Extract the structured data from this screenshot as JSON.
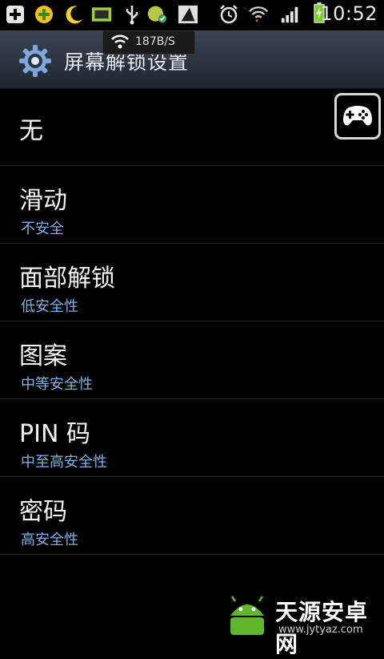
{
  "status_bar": {
    "time": "10:52",
    "net_speed": "187B/S",
    "icons": [
      "plus-icon",
      "coin-app-icon",
      "moon-icon",
      "sim-icon",
      "usb-icon",
      "app-check-icon",
      "sail-app-icon",
      "alarm-icon",
      "wifi-icon",
      "signal-icon",
      "battery-charging-icon"
    ]
  },
  "header": {
    "title": "屏幕解锁设置",
    "icon": "gear-icon"
  },
  "options": [
    {
      "label": "无",
      "sub": ""
    },
    {
      "label": "滑动",
      "sub": "不安全"
    },
    {
      "label": "面部解锁",
      "sub": "低安全性"
    },
    {
      "label": "图案",
      "sub": "中等安全性"
    },
    {
      "label": "PIN 码",
      "sub": "中至高安全性"
    },
    {
      "label": "密码",
      "sub": "高安全性"
    }
  ],
  "overlay": {
    "icon": "gamepad-icon"
  },
  "watermark": {
    "text": "天源安卓网",
    "url": "www.jytyaz.com"
  },
  "colors": {
    "background": "#000000",
    "header_top": "#3b4452",
    "subtitle": "#7fb2e3"
  }
}
